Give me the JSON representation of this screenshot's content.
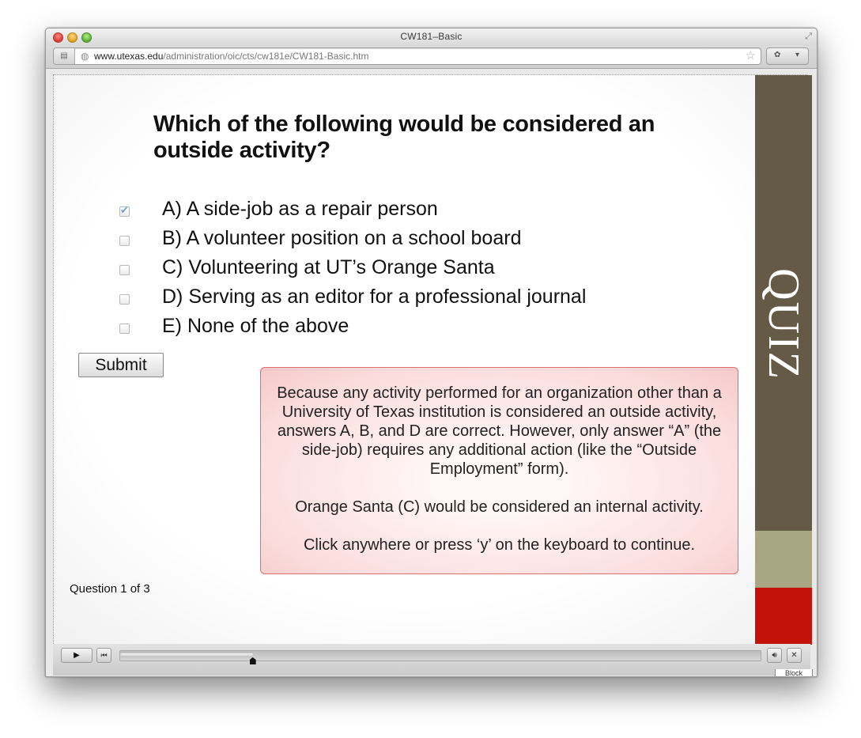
{
  "window": {
    "title": "CW181–Basic"
  },
  "address_bar": {
    "host": "www.utexas.edu",
    "path": "/administration/oic/cts/cw181e/CW181-Basic.htm"
  },
  "quiz": {
    "question": "Which of the following would be considered an outside activity?",
    "answers": [
      {
        "label": "A) A side-job as a repair person",
        "checked": true
      },
      {
        "label": "B) A volunteer position on a school board",
        "checked": false
      },
      {
        "label": "C) Volunteering at UT’s Orange Santa",
        "checked": false
      },
      {
        "label": "D) Serving as an editor for a professional journal",
        "checked": false
      },
      {
        "label": "E) None of the above",
        "checked": false
      }
    ],
    "submit_label": "Submit",
    "feedback": {
      "paragraph1": "Because any activity performed for an organization other than a University of Texas institution is considered an outside activity, answers A, B, and D are correct.  However, only answer “A” (the side-job) requires any additional action (like the “Outside Employment” form).",
      "paragraph2": "Orange Santa (C) would be considered an internal activity.",
      "paragraph3": "Click anywhere or press ‘y’ on the keyboard to continue."
    },
    "counter": "Question 1 of 3",
    "side_label": "QUIZ"
  },
  "player": {
    "progress": 0.207,
    "block_label": "Block"
  },
  "colors": {
    "band_dark": "#645a45",
    "band_olive": "#a8a784",
    "band_red": "#c4120a",
    "feedback_border": "#d9706b"
  }
}
